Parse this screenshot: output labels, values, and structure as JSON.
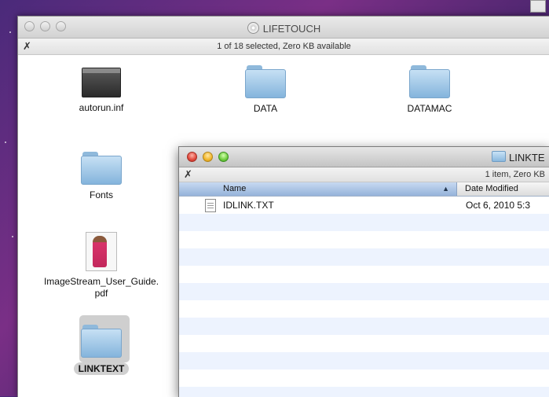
{
  "back_window": {
    "title": "LIFETOUCH",
    "status": "1 of 18 selected, Zero KB available",
    "icons": [
      {
        "label": "autorun.inf",
        "type": "executable"
      },
      {
        "label": "DATA",
        "type": "folder"
      },
      {
        "label": "DATAMAC",
        "type": "folder"
      },
      {
        "label": "Fonts",
        "type": "folder"
      },
      {
        "label": "ImageStream_User_Guide.",
        "label2": "pdf",
        "type": "pdf"
      },
      {
        "label": "LINKTEXT",
        "type": "folder",
        "selected": true
      }
    ]
  },
  "front_window": {
    "title": "LINKTE",
    "status": "1 item, Zero KB",
    "columns": {
      "name": "Name",
      "date": "Date Modified"
    },
    "rows": [
      {
        "name": "IDLINK.TXT",
        "date": "Oct 6, 2010 5:3"
      }
    ]
  },
  "colors": {
    "folder": "#9cc4e6",
    "header_selected": "#a9c3e6",
    "row_alt": "#edf3fe"
  }
}
